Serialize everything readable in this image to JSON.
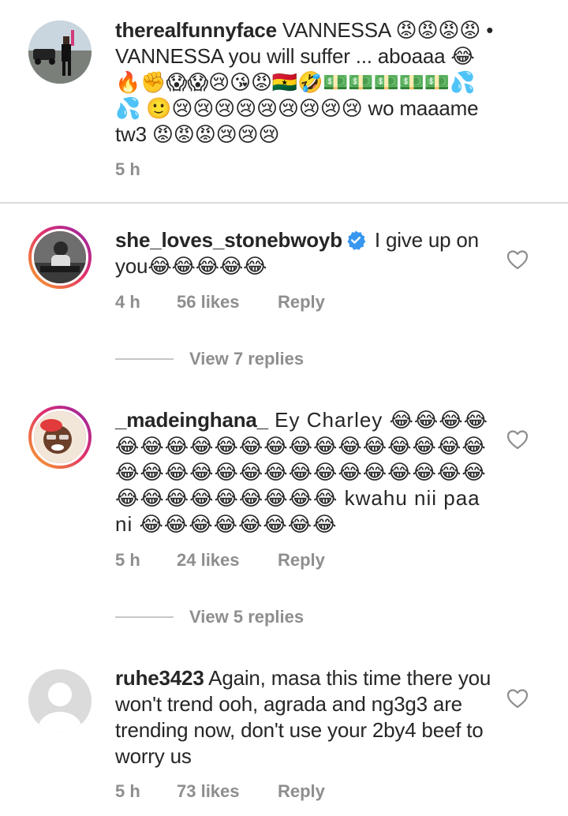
{
  "comments": [
    {
      "username": "therealfunnyface",
      "body": " VANNESSA 😡😡😡😡 • VANNESSA you will suffer ... aboaaa 😂🔥✊😱😱😢😘😡🇬🇭🤣💵💵💵💵💵💦💦 🙂😢😢😢😢😢😢😢😢😢 wo maaame tw3 😡😡😡😢😢😢",
      "time": "5 h"
    },
    {
      "username": "she_loves_stonebwoyb",
      "verified": true,
      "body": " I give up on you😂😂😂😂😂",
      "time": "4 h",
      "likes": "56 likes",
      "reply": "Reply",
      "view_replies": "View 7 replies"
    },
    {
      "username": "_madeinghana_",
      "body": " Ey Charley 😂😂😂😂😂😂😂😂😂😂😂😂😂😂😂😂😂😂😂😂😂😂😂😂😂😂😂😂😂😂😂😂😂😂😂😂😂😂😂😂😂😂😂 kwahu nii paa ni 😂😂😂😂😂😂😂😂",
      "time": "5 h",
      "likes": "24 likes",
      "reply": "Reply",
      "view_replies": "View 5 replies"
    },
    {
      "username": "ruhe3423",
      "body": " Again, masa this time there you won't trend ooh, agrada and ng3g3 are trending now, don't use your 2by4 beef to worry us",
      "time": "5 h",
      "likes": "73 likes",
      "reply": "Reply"
    }
  ],
  "icons": {
    "like": "heart-outline-icon",
    "verified": "verified-badge-icon"
  },
  "colors": {
    "text": "#262626",
    "secondary": "#8e8e8e",
    "verified": "#3897f0",
    "divider": "#dbdbdb"
  }
}
